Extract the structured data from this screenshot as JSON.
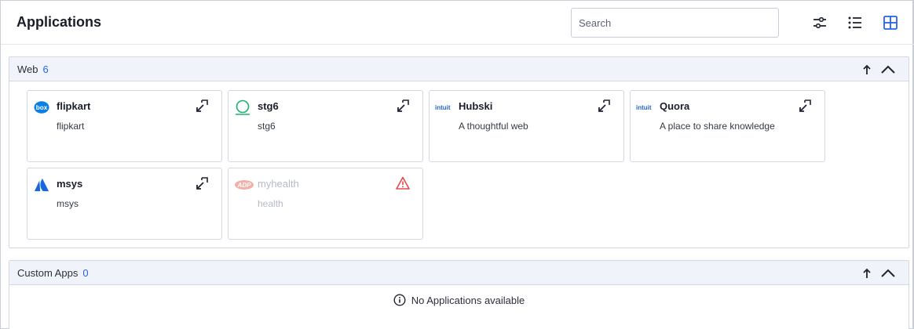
{
  "header": {
    "title": "Applications",
    "search_placeholder": "Search"
  },
  "colors": {
    "accent": "#2563eb",
    "section_header_bg": "#f0f4fa",
    "warning": "#e5484d",
    "success_ring": "#19b36b",
    "box_blue": "#0b7ee8",
    "atlassian_blue": "#1868db",
    "intuit_blue": "#2566c8",
    "disabled_logo": "#f2b0a8"
  },
  "sections": [
    {
      "title": "Web",
      "count": "6",
      "apps": [
        {
          "name": "flipkart",
          "description": "flipkart",
          "logo": "box-logo-icon",
          "logo_text": "box",
          "action": "launch-arrow-icon"
        },
        {
          "name": "stg6",
          "description": "stg6",
          "logo": "ring-logo-icon",
          "action": "launch-arrow-icon"
        },
        {
          "name": "Hubski",
          "description": "A thoughtful web",
          "logo": "intuit-logo-icon",
          "logo_text": "intuit",
          "action": "launch-arrow-icon"
        },
        {
          "name": "Quora",
          "description": "A place to share knowledge",
          "logo": "intuit-logo-icon",
          "logo_text": "intuit",
          "action": "launch-arrow-icon"
        },
        {
          "name": "msys",
          "description": "msys",
          "logo": "atlassian-logo-icon",
          "action": "launch-arrow-icon"
        },
        {
          "name": "myhealth",
          "description": "health",
          "logo": "adp-logo-icon",
          "logo_text": "ADP",
          "action": "warning-triangle-icon",
          "disabled": true
        }
      ]
    },
    {
      "title": "Custom Apps",
      "count": "0",
      "empty_message": "No Applications available"
    }
  ]
}
